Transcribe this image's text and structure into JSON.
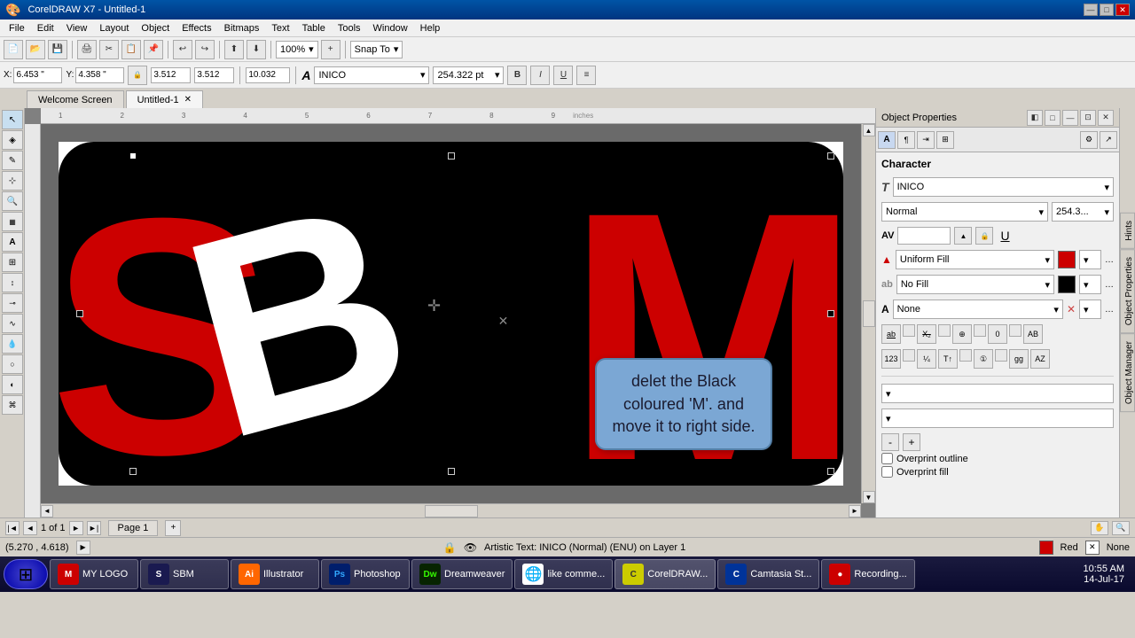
{
  "titlebar": {
    "title": "CorelDRAW X7 - Untitled-1",
    "minimize": "—",
    "maximize": "□",
    "close": "✕"
  },
  "menubar": {
    "items": [
      "File",
      "Edit",
      "View",
      "Layout",
      "Object",
      "Effects",
      "Bitmaps",
      "Text",
      "Table",
      "Tools",
      "Window",
      "Help"
    ]
  },
  "toolbar1": {
    "zoom": "100%",
    "snap": "Snap To"
  },
  "toolbar2": {
    "x_label": "X:",
    "x_value": "6.453 \"",
    "y_label": "Y:",
    "y_value": "4.358 \"",
    "w_value": "3.512",
    "h_value": "3.512",
    "angle": "10.032",
    "font": "INICO",
    "size": "254.322 pt"
  },
  "tabs": {
    "items": [
      "Welcome Screen",
      "Untitled-1"
    ]
  },
  "canvas": {
    "page_label": "Page 1",
    "units": "inches"
  },
  "tooltip": {
    "text": "delet the Black coloured 'M'. and move it to right side."
  },
  "rightpanel": {
    "title": "Object Properties",
    "section": "Character",
    "font": "INICO",
    "style": "Normal",
    "size": "254.3...",
    "fill_label": "Uniform Fill",
    "outline_label": "No Fill",
    "none_label": "None",
    "overprint_outline": "Overprint outline",
    "overprint_fill": "Overprint fill"
  },
  "sidetabs": {
    "items": [
      "Hints",
      "Object Properties",
      "Object Manager"
    ]
  },
  "statusbar": {
    "page": "1 of 1",
    "page_name": "Page 1"
  },
  "bottomstatus": {
    "text": "Artistic Text: INICO (Normal) (ENU) on Layer 1",
    "fill_color": "Red",
    "outline": "None",
    "coords": "5.270 , 4.618"
  },
  "taskbar": {
    "time": "10:55 AM",
    "date": "14-Jul-17",
    "apps": [
      "MY LOGO",
      "SBM",
      "Illustrator",
      "Photoshop",
      "Dreamweaver",
      "Chrome",
      "like comme...",
      "CorelDRAW...",
      "Camtasia St...",
      "Recording..."
    ]
  }
}
